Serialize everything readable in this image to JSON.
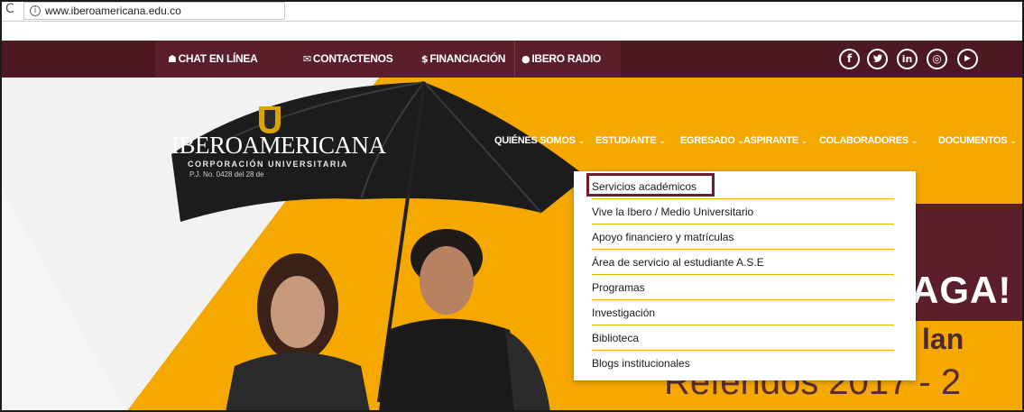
{
  "browser": {
    "url": "www.iberoamericana.edu.co"
  },
  "topnav": {
    "items": [
      {
        "icon": "users-icon",
        "label": "CHAT EN LÍNEA"
      },
      {
        "icon": "envelope-icon",
        "label": "CONTACTENOS"
      },
      {
        "icon": "dollar-icon",
        "label": "FINANCIACIÓN"
      },
      {
        "icon": "microphone-icon",
        "label": "IBERO RADIO"
      }
    ],
    "social": [
      {
        "icon": "facebook-icon",
        "glyph": "f"
      },
      {
        "icon": "twitter-icon",
        "glyph": "t"
      },
      {
        "icon": "linkedin-icon",
        "glyph": "in"
      },
      {
        "icon": "instagram-icon",
        "glyph": "◎"
      },
      {
        "icon": "youtube-icon",
        "glyph": "▶"
      }
    ]
  },
  "logo": {
    "name": "IBEROAMERICANA",
    "subtitle": "CORPORACIÓN UNIVERSITARIA",
    "resolution": "P.J. No. 0428 del 28 de"
  },
  "mainnav": {
    "items": [
      "QUIÉNES SOMOS",
      "ESTUDIANTE",
      "EGRESADO",
      "ASPIRANTE",
      "COLABORADORES",
      "DOCUMENTOS"
    ],
    "active": "ESTUDIANTE"
  },
  "dropdown": {
    "items": [
      "Servicios académicos",
      "Vive la Ibero / Medio Universitario",
      "Apoyo financiero y matrículas",
      "Área de servicio al estudiante A.S.E",
      "Programas",
      "Investigación",
      "Biblioteca",
      "Blogs institucionales"
    ],
    "highlighted": "Servicios académicos"
  },
  "promo": {
    "line1": "AGA!",
    "line2": "lan",
    "line3": "Referidos 2017 - 2"
  },
  "colors": {
    "maroon": "#5b1f2b",
    "gold": "#f5a800",
    "highlight_border": "#6b1d2b"
  }
}
